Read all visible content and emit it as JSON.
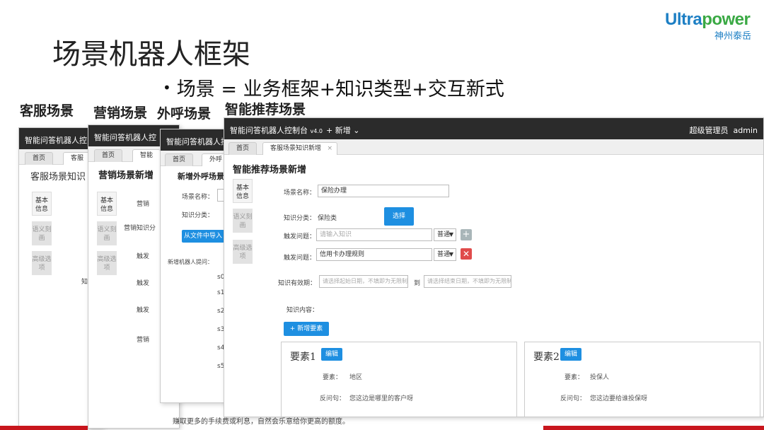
{
  "slide": {
    "title": "场景机器人框架",
    "bullet": "场景 = 业务框架+知识类型+交互新式",
    "logo_word_a": "Ultra",
    "logo_word_b": "power",
    "logo_sub": "神州泰岳",
    "bottom_note": "赚取更多的手续费或利息，自然会乐意给你更高的额度。"
  },
  "card_titles": [
    "客服场景",
    "营销场景",
    "外呼场景",
    "智能推荐场景"
  ],
  "win1": {
    "app_title": "智能问答机器人控",
    "tabs": [
      "首页",
      "客服"
    ],
    "header": "客服场景知识",
    "side": [
      "基本信息",
      "语义刻画",
      "高级选项"
    ],
    "snippet": "知"
  },
  "win2": {
    "app_title": "智能问答机器人控",
    "tabs": [
      "首页",
      "智能"
    ],
    "header": "营销场景新增",
    "side": [
      "基本信息",
      "语义刻画",
      "高级选项"
    ],
    "labels": [
      "营销",
      "营销知识分",
      "触发",
      "触发",
      "触发",
      "营销"
    ]
  },
  "win3": {
    "app_title": "智能问答机器人控",
    "tabs": [
      "首页",
      "外呼"
    ],
    "header": "新增外呼场景",
    "scene_name_label": "场景名称：",
    "category_label": "知识分类：",
    "import_button": "从文件中导入",
    "robot_q_label": "新增机器人提问：",
    "steps": [
      "s0",
      "s1",
      "s2",
      "s3",
      "s4",
      "s5"
    ]
  },
  "win4": {
    "app_title": "智能问答机器人控制台",
    "version": "v4.0",
    "new_menu": "+ 新增",
    "admin_role": "超级管理员",
    "admin_user": "admin",
    "tabs": [
      "首页",
      "客服场景知识新增"
    ],
    "header": "智能推荐场景新增",
    "side": [
      "基本信息",
      "语义刻画",
      "高级选项"
    ],
    "scene_name_label": "场景名称：",
    "scene_name_value": "保险办理",
    "category_label": "知识分类：",
    "category_value": "保险类",
    "select_button": "选择",
    "trigger_label": "触发问题：",
    "trigger1_placeholder": "请输入知识",
    "trigger1_mode": "普通",
    "trigger2_value": "信用卡办理规则",
    "trigger2_mode": "普通",
    "validity_label": "知识有效期：",
    "start_placeholder": "请选择起始日期，不填即为无限制",
    "to_label": "到",
    "end_placeholder": "请选择结束日期，不填即为无限制",
    "content_label": "知识内容：",
    "add_element_button": "+ 新增要素",
    "elements": [
      {
        "title": "要素1",
        "edit": "编辑",
        "key_label": "要素：",
        "key_value": "地区",
        "q_label": "反问句：",
        "q_value": "您这边是哪里的客户呀"
      },
      {
        "title": "要素2",
        "edit": "编辑",
        "key_label": "要素：",
        "key_value": "投保人",
        "q_label": "反问句：",
        "q_value": "您这边要给谁投保呀"
      }
    ]
  }
}
